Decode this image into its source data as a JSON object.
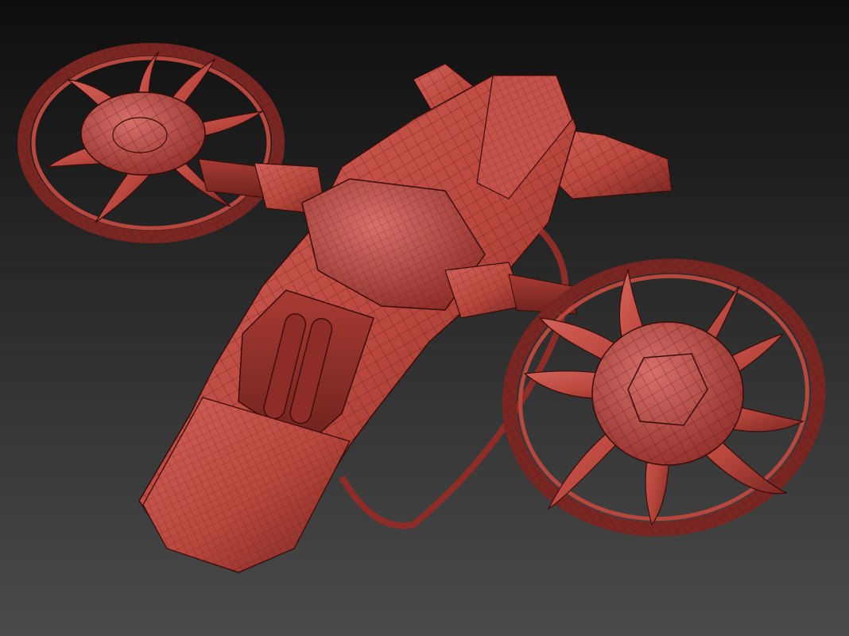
{
  "viewport": {
    "background_top": "#0e0e0e",
    "background_bottom": "#4a4a4a"
  },
  "model": {
    "subject": "drone-aircraft-wireframe-model",
    "shade_color": "#b9473d",
    "shade_highlight": "#d3625a",
    "shade_dark": "#7a2622",
    "wire_color": "#3a0c0a"
  }
}
